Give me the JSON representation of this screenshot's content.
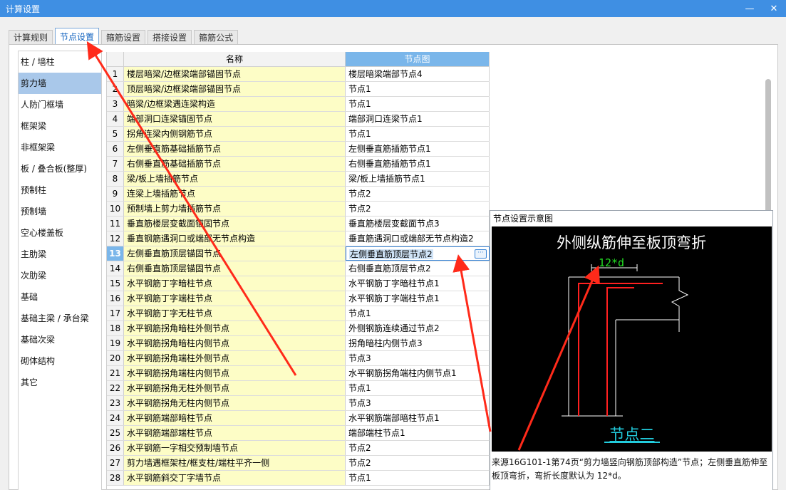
{
  "window": {
    "title": "计算设置"
  },
  "tabs": [
    {
      "label": "计算规则"
    },
    {
      "label": "节点设置"
    },
    {
      "label": "箍筋设置"
    },
    {
      "label": "搭接设置"
    },
    {
      "label": "箍筋公式"
    }
  ],
  "sidebar": {
    "items": [
      {
        "label": "柱 / 墙柱"
      },
      {
        "label": "剪力墙"
      },
      {
        "label": "人防门框墙"
      },
      {
        "label": "框架梁"
      },
      {
        "label": "非框架梁"
      },
      {
        "label": "板 / 叠合板(整厚)"
      },
      {
        "label": "预制柱"
      },
      {
        "label": "预制墙"
      },
      {
        "label": "空心楼盖板"
      },
      {
        "label": "主肋梁"
      },
      {
        "label": "次肋梁"
      },
      {
        "label": "基础"
      },
      {
        "label": "基础主梁 / 承台梁"
      },
      {
        "label": "基础次梁"
      },
      {
        "label": "砌体结构"
      },
      {
        "label": "其它"
      }
    ]
  },
  "table": {
    "headers": {
      "name": "名称",
      "node": "节点图"
    },
    "rows": [
      {
        "idx": "1",
        "name": "楼层暗梁/边框梁端部锚固节点",
        "node": "楼层暗梁端部节点4"
      },
      {
        "idx": "2",
        "name": "顶层暗梁/边框梁端部锚固节点",
        "node": "节点1"
      },
      {
        "idx": "3",
        "name": "暗梁/边框梁遇连梁构造",
        "node": "节点1"
      },
      {
        "idx": "4",
        "name": "端部洞口连梁锚固节点",
        "node": "端部洞口连梁节点1"
      },
      {
        "idx": "5",
        "name": "拐角连梁内侧钢筋节点",
        "node": "节点1"
      },
      {
        "idx": "6",
        "name": "左侧垂直筋基础插筋节点",
        "node": "左侧垂直筋插筋节点1"
      },
      {
        "idx": "7",
        "name": "右侧垂直筋基础插筋节点",
        "node": "右侧垂直筋插筋节点1"
      },
      {
        "idx": "8",
        "name": "梁/板上墙插筋节点",
        "node": "梁/板上墙插筋节点1"
      },
      {
        "idx": "9",
        "name": "连梁上墙插筋节点",
        "node": "节点2"
      },
      {
        "idx": "10",
        "name": "预制墙上剪力墙插筋节点",
        "node": "节点2"
      },
      {
        "idx": "11",
        "name": "垂直筋楼层变截面锚固节点",
        "node": "垂直筋楼层变截面节点3"
      },
      {
        "idx": "12",
        "name": "垂直钢筋遇洞口或端部无节点构造",
        "node": "垂直筋遇洞口或端部无节点构造2"
      },
      {
        "idx": "13",
        "name": "左侧垂直筋顶层锚固节点",
        "node": "左侧垂直筋顶层节点2"
      },
      {
        "idx": "14",
        "name": "右侧垂直筋顶层锚固节点",
        "node": "右侧垂直筋顶层节点2"
      },
      {
        "idx": "15",
        "name": "水平钢筋丁字暗柱节点",
        "node": "水平钢筋丁字暗柱节点1"
      },
      {
        "idx": "16",
        "name": "水平钢筋丁字端柱节点",
        "node": "水平钢筋丁字端柱节点1"
      },
      {
        "idx": "17",
        "name": "水平钢筋丁字无柱节点",
        "node": "节点1"
      },
      {
        "idx": "18",
        "name": "水平钢筋拐角暗柱外侧节点",
        "node": "外侧钢筋连续通过节点2"
      },
      {
        "idx": "19",
        "name": "水平钢筋拐角暗柱内侧节点",
        "node": "拐角暗柱内侧节点3"
      },
      {
        "idx": "20",
        "name": "水平钢筋拐角端柱外侧节点",
        "node": "节点3"
      },
      {
        "idx": "21",
        "name": "水平钢筋拐角端柱内侧节点",
        "node": "水平钢筋拐角端柱内侧节点1"
      },
      {
        "idx": "22",
        "name": "水平钢筋拐角无柱外侧节点",
        "node": "节点1"
      },
      {
        "idx": "23",
        "name": "水平钢筋拐角无柱内侧节点",
        "node": "节点3"
      },
      {
        "idx": "24",
        "name": "水平钢筋端部暗柱节点",
        "node": "水平钢筋端部暗柱节点1"
      },
      {
        "idx": "25",
        "name": "水平钢筋端部端柱节点",
        "node": "端部端柱节点1"
      },
      {
        "idx": "26",
        "name": "水平钢筋一字相交预制墙节点",
        "node": "节点2"
      },
      {
        "idx": "27",
        "name": "剪力墙遇框架柱/框支柱/端柱平齐一侧",
        "node": "节点2"
      },
      {
        "idx": "28",
        "name": "水平钢筋斜交丁字墙节点",
        "node": "节点1"
      }
    ],
    "selected_row": "13",
    "edit_button": "···"
  },
  "preview": {
    "title": "节点设置示意图",
    "diagram_heading": "外侧纵筋伸至板顶弯折",
    "dimension_label": "12*d",
    "node_label": "节点二",
    "description": "来源16G101-1第74页“剪力墙竖向钢筋顶部构造”节点；左侧垂直筋伸至板顶弯折，弯折长度默认为 12*d。"
  },
  "colors": {
    "titlebar": "#3f8fe3",
    "selected_nav": "#a9c8ea",
    "name_cell": "#fdfdc6",
    "header_accent": "#7ab6ea",
    "annotation_arrow": "#ff2a1a",
    "diagram_dimension": "#22dd22",
    "diagram_node_label": "#22ccdd"
  },
  "icons": [
    "minimize-icon",
    "close-icon",
    "ellipsis-icon"
  ]
}
